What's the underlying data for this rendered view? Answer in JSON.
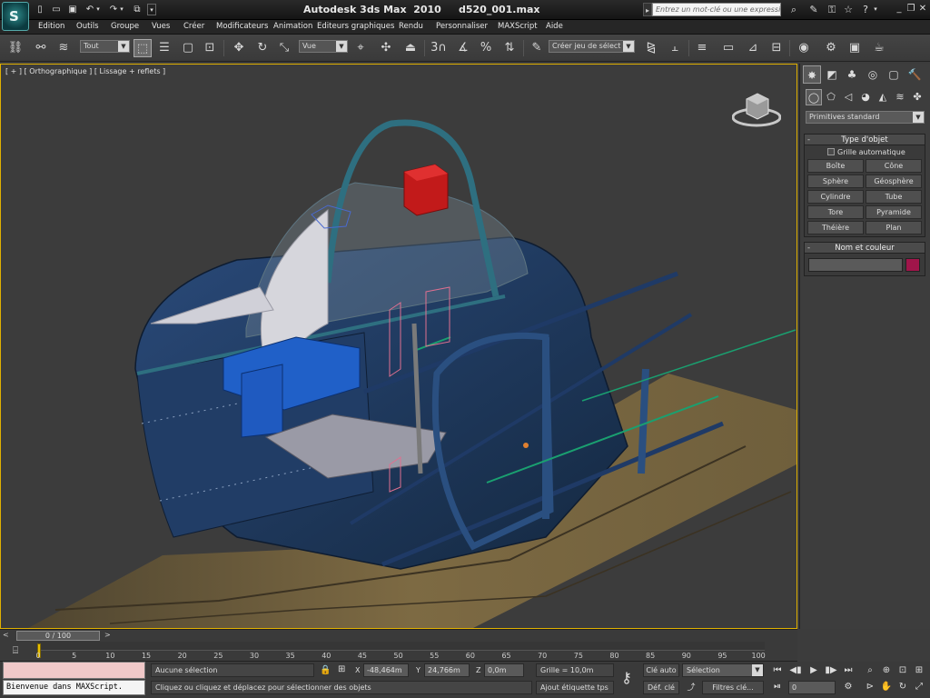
{
  "app": {
    "title": "Autodesk 3ds Max  2010",
    "filename": "d520_001.max",
    "logo_glyph": "S",
    "quick_access_icons": [
      "new-file-icon",
      "open-file-icon",
      "save-icon",
      "undo-icon",
      "redo-icon",
      "project-folder-icon"
    ],
    "infocenter": {
      "search_placeholder": "Entrez un mot-clé ou une expressio",
      "icons": [
        "binoculars-icon",
        "tools-icon",
        "star-icon",
        "help-icon"
      ]
    }
  },
  "menu": [
    "Edition",
    "Outils",
    "Groupe",
    "Vues",
    "Créer",
    "Modificateurs",
    "Animation",
    "Editeurs graphiques",
    "Rendu",
    "Personnaliser",
    "MAXScript",
    "Aide"
  ],
  "toolbar": {
    "selection_filter": "Tout",
    "reference_coord": "Vue",
    "named_selection": "Créer jeu de sélect",
    "snap_label": "3"
  },
  "viewport": {
    "label": "[ + ] [ Orthographique ] [ Lissage + reflets ]",
    "border_color": "#e0b000"
  },
  "command_panel": {
    "category": "Primitives standard",
    "object_type": {
      "title": "Type d'objet",
      "autogrid": "Grille automatique",
      "buttons": [
        "Boîte",
        "Cône",
        "Sphère",
        "Géosphère",
        "Cylindre",
        "Tube",
        "Tore",
        "Pyramide",
        "Théière",
        "Plan"
      ]
    },
    "name_color": {
      "title": "Nom et couleur",
      "name_value": "",
      "color": "#a0154a"
    }
  },
  "time": {
    "slider_label": "0 / 100",
    "prev": "<",
    "next": ">",
    "ticks": [
      "0",
      "5",
      "10",
      "15",
      "20",
      "25",
      "30",
      "35",
      "40",
      "45",
      "50",
      "55",
      "60",
      "65",
      "70",
      "75",
      "80",
      "85",
      "90",
      "95",
      "100"
    ]
  },
  "status": {
    "maxscript_output": "Bienvenue dans MAXScript.",
    "selection": "Aucune sélection",
    "prompt": "Cliquez ou cliquez et déplacez pour sélectionner des objets",
    "x_label": "X",
    "x_value": "-48,464m",
    "y_label": "Y",
    "y_value": "24,766m",
    "z_label": "Z",
    "z_value": "0,0m",
    "grid": "Grille = 10,0m",
    "add_time_tag": "Ajout étiquette tps",
    "auto_key": "Clé auto",
    "set_key": "Déf. clé",
    "key_filter_selection": "Sélection",
    "key_filters": "Filtres clé...",
    "current_frame": "0"
  }
}
